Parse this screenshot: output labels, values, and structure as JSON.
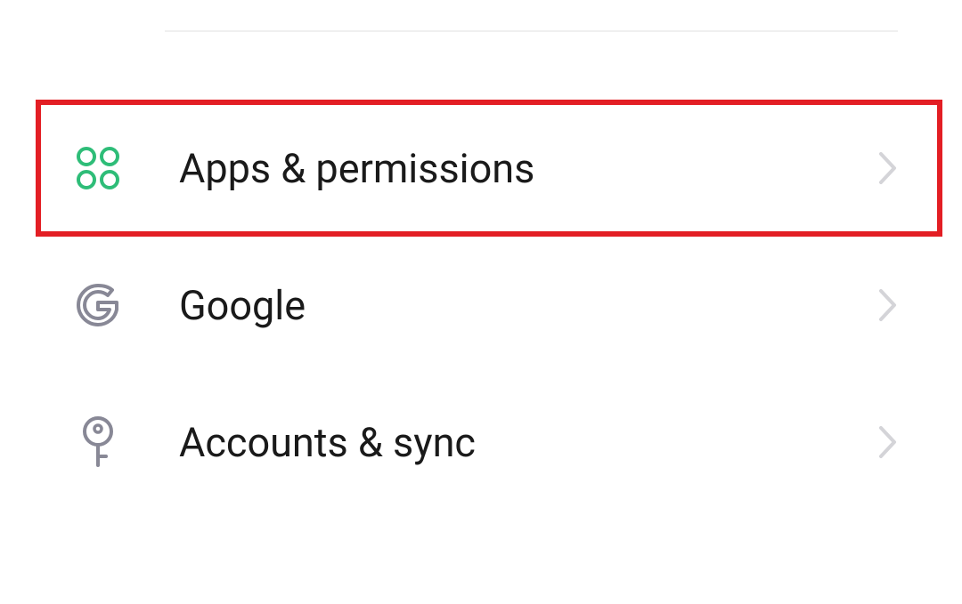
{
  "settings": {
    "items": [
      {
        "label": "Apps & permissions",
        "icon": "apps-grid",
        "highlighted": true
      },
      {
        "label": "Google",
        "icon": "google",
        "highlighted": false
      },
      {
        "label": "Accounts & sync",
        "icon": "key",
        "highlighted": false
      }
    ]
  },
  "colors": {
    "highlight": "#e31e24",
    "iconGreen": "#2ebd78",
    "iconGray": "#888896",
    "chevronGray": "#d4d4d8"
  }
}
